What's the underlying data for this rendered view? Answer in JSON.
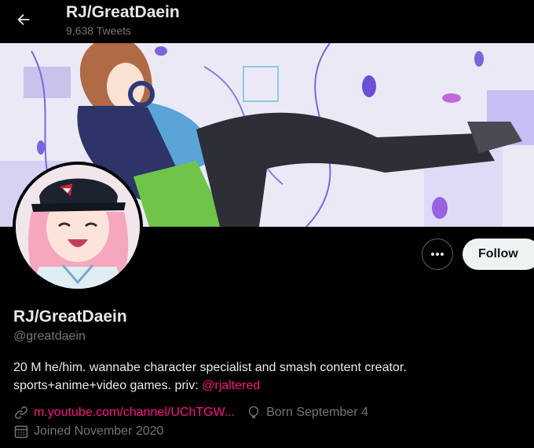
{
  "header": {
    "display_name": "RJ/GreatDaein",
    "tweet_count": "9,638 Tweets"
  },
  "profile": {
    "display_name": "RJ/GreatDaein",
    "handle": "@greatdaein",
    "bio_line1": "20 M he/him. wannabe character specialist and smash content creator.",
    "bio_line2_text": "sports+anime+video games. priv: ",
    "bio_mention": "@rjaltered",
    "website": "m.youtube.com/channel/UChTGW...",
    "birthday": "Born September 4",
    "joined": "Joined November 2020"
  },
  "actions": {
    "follow_label": "Follow",
    "more_icon": "more-dots-icon"
  },
  "icons": {
    "back": "back-arrow-icon",
    "link": "link-icon",
    "birthday": "balloon-icon",
    "calendar": "calendar-icon"
  },
  "colors": {
    "background": "#000000",
    "accent": "#f91880",
    "muted": "#71767b",
    "follow_bg": "#eff3f4"
  }
}
